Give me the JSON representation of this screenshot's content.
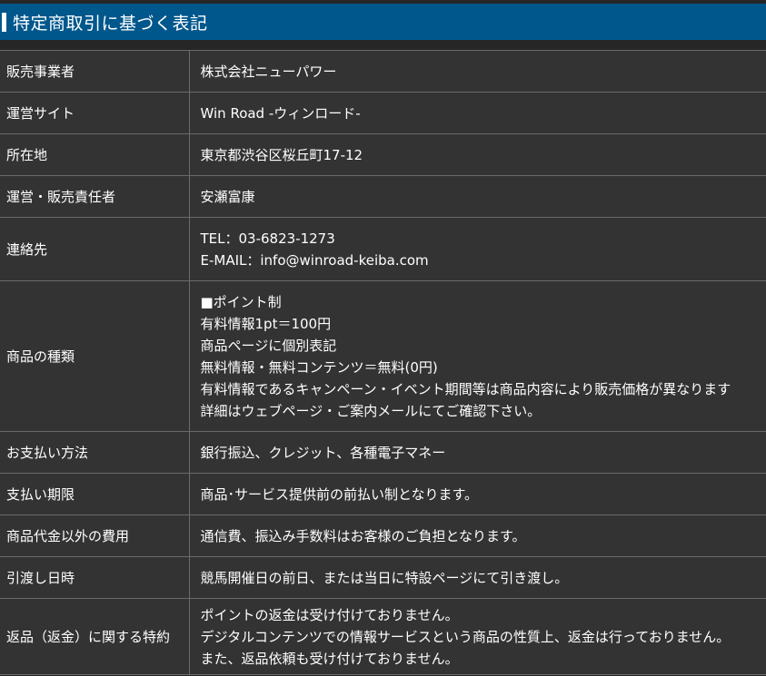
{
  "header": {
    "title": "特定商取引に基づく表記"
  },
  "rows": [
    {
      "label": "販売事業者",
      "lines": [
        "株式会社ニューパワー"
      ]
    },
    {
      "label": "運営サイト",
      "lines": [
        "Win Road -ウィンロード-"
      ]
    },
    {
      "label": "所在地",
      "lines": [
        "東京都渋谷区桜丘町17-12"
      ]
    },
    {
      "label": "運営・販売責任者",
      "lines": [
        "安瀬富康"
      ]
    },
    {
      "label": "連絡先",
      "lines": [
        "TEL：03-6823-1273",
        "E-MAIL：info@winroad-keiba.com"
      ]
    },
    {
      "label": "商品の種類",
      "lines": [
        "■ポイント制",
        "有料情報1pt＝100円",
        "商品ページに個別表記",
        "無料情報・無料コンテンツ＝無料(0円)",
        "有料情報であるキャンペーン・イベント期間等は商品内容により販売価格が異なります",
        "詳細はウェブページ・ご案内メールにてご確認下さい。"
      ]
    },
    {
      "label": "お支払い方法",
      "lines": [
        "銀行振込、クレジット、各種電子マネー"
      ]
    },
    {
      "label": "支払い期限",
      "lines": [
        "商品･サービス提供前の前払い制となります。"
      ]
    },
    {
      "label": "商品代金以外の費用",
      "lines": [
        "通信費、振込み手数料はお客様のご負担となります。"
      ]
    },
    {
      "label": "引渡し日時",
      "lines": [
        "競馬開催日の前日、または当日に特設ページにて引き渡し。"
      ]
    },
    {
      "label": "返品（返金）に関する特約",
      "lines": [
        "ポイントの返金は受け付けておりません。",
        "デジタルコンテンツでの情報サービスという商品の性質上、返金は行っておりません。",
        "また、返品依頼も受け付けておりません。"
      ]
    }
  ]
}
